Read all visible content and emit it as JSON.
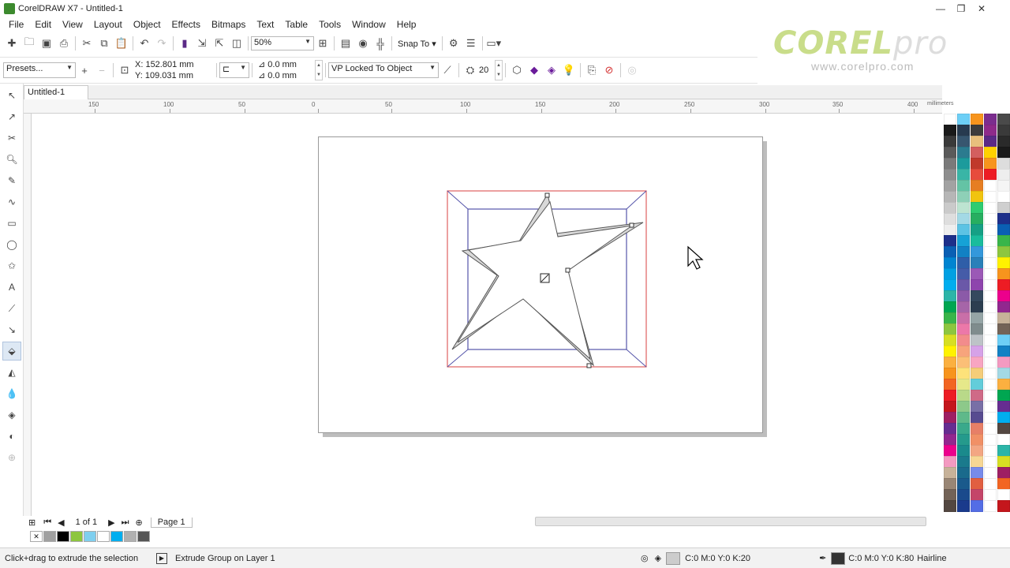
{
  "window": {
    "title": "CorelDRAW X7 - Untitled-1",
    "minimize": "—",
    "restore": "❐",
    "close": "✕"
  },
  "menu": [
    "File",
    "Edit",
    "View",
    "Layout",
    "Object",
    "Effects",
    "Bitmaps",
    "Text",
    "Table",
    "Tools",
    "Window",
    "Help"
  ],
  "standard_toolbar": {
    "zoom": "50%",
    "snap_to": "Snap To"
  },
  "property_bar": {
    "presets": "Presets...",
    "x": "X: 152.801 mm",
    "y": "Y: 109.031 mm",
    "offset_x": "0.0 mm",
    "offset_y": "0.0 mm",
    "vp_mode": "VP Locked To Object",
    "depth": "20"
  },
  "logo": {
    "text": "COREL",
    "suffix": "pro",
    "url": "www.corelpro.com"
  },
  "document_tab": "Untitled-1",
  "ruler": {
    "units": "millimeters",
    "ticks": [
      {
        "label": "150",
        "pos": 120
      },
      {
        "label": "100",
        "pos": 215
      },
      {
        "label": "50",
        "pos": 310
      },
      {
        "label": "0",
        "pos": 403
      },
      {
        "label": "50",
        "pos": 496
      },
      {
        "label": "100",
        "pos": 591
      },
      {
        "label": "150",
        "pos": 686
      },
      {
        "label": "200",
        "pos": 780
      },
      {
        "label": "250",
        "pos": 875
      },
      {
        "label": "300",
        "pos": 970
      },
      {
        "label": "350",
        "pos": 1063
      },
      {
        "label": "400",
        "pos": 1158
      }
    ]
  },
  "page_nav": {
    "counter": "1 of 1",
    "page_tab": "Page 1"
  },
  "status": {
    "hint": "Click+drag to extrude the selection",
    "object": "Extrude Group on Layer 1",
    "fill": "C:0 M:0 Y:0 K:20",
    "outline": "C:0 M:0 Y:0 K:80",
    "outline_width": "Hairline"
  },
  "colors": {
    "fill_swatch": "#cccccc",
    "outline_swatch": "#333333",
    "bbox_red": "#e06060",
    "bbox_blue": "#5555aa",
    "extrude_gray": "#d8d8d8"
  },
  "document_palette": [
    "#a0a0a0",
    "#000000",
    "#8dc63f",
    "#7fcfef",
    "#ffffff",
    "#00aeef",
    "#b0b0b0",
    "#555555"
  ]
}
